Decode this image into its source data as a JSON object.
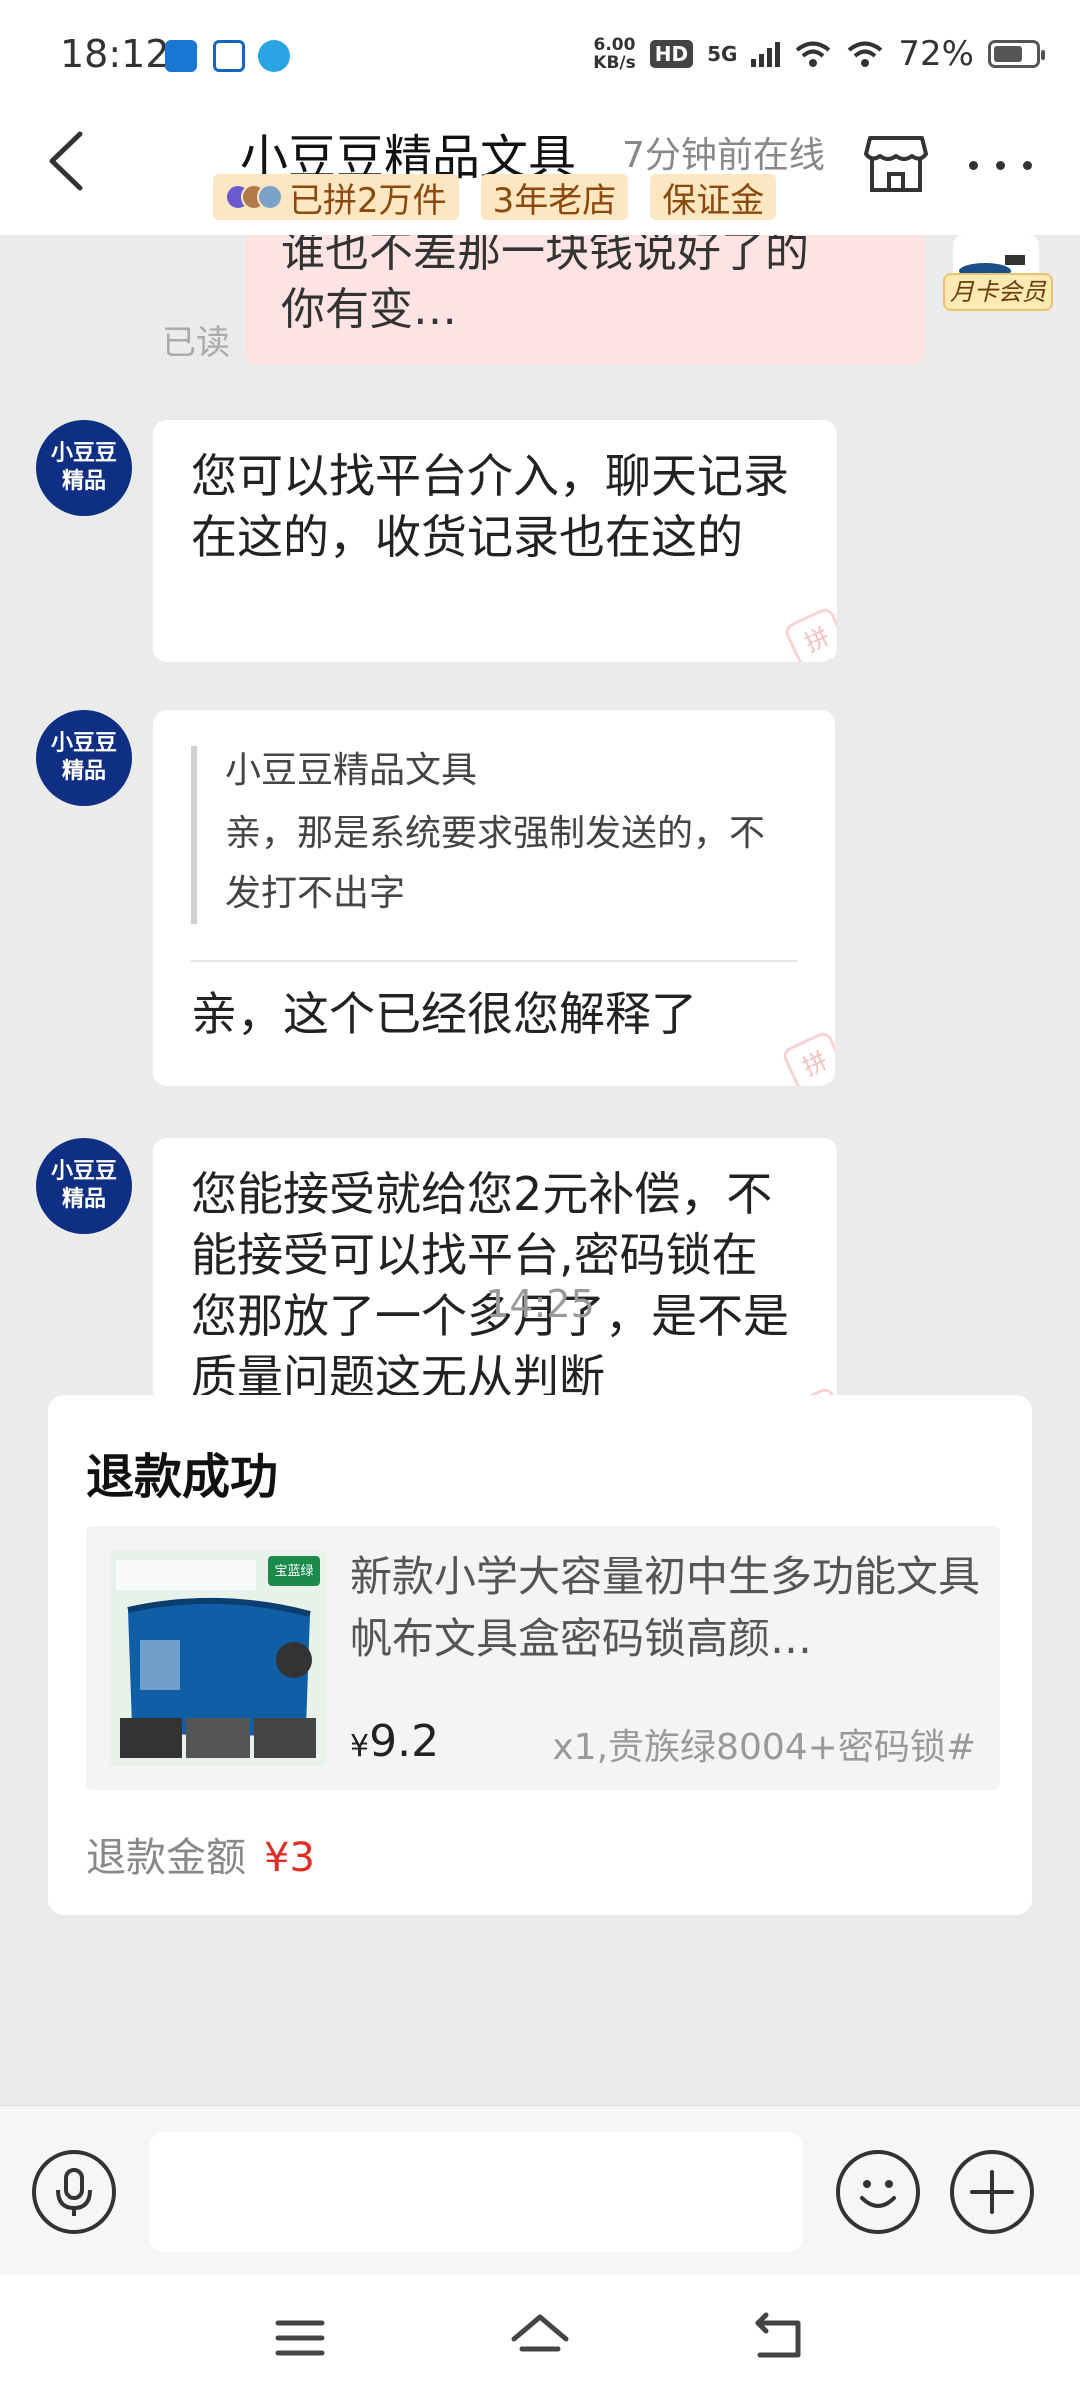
{
  "status_bar": {
    "time": "18:12",
    "net_speed_value": "6.00",
    "net_speed_unit": "KB/s",
    "hd_label": "HD",
    "network_label": "5G",
    "battery_percent": "72%",
    "battery_level": 0.72
  },
  "header": {
    "shop_name": "小豆豆精品文具",
    "online_status": "7分钟前在线",
    "badges": [
      "已拼2万件",
      "3年老店",
      "保证金"
    ],
    "icons": [
      "back-arrow-icon",
      "store-icon",
      "more-icon"
    ]
  },
  "messages": {
    "outgoing_text_line1": "谁也不差那一块钱说好了的",
    "outgoing_text_line2": "你有变…",
    "read_status": "已读",
    "member_badge": "月卡会员",
    "shop_avatar_line1": "小豆豆",
    "shop_avatar_line2": "精品",
    "msg1": "您可以找平台介入，聊天记录在这的，收货记录也在这的",
    "msg2_quote_author": "小豆豆精品文具",
    "msg2_quote_text": "亲，那是系统要求强制发送的，不发打不出字",
    "msg2_reply": "亲，这个已经很您解释了",
    "msg3": "您能接受就给您2元补偿，不能接受可以找平台,密码锁在您那放了一个多月了，是不是质量问题这无从判断",
    "pin_mark": "拼",
    "timestamp": "14:25"
  },
  "refund_card": {
    "title": "退款成功",
    "product_name": "新款小学大容量初中生多功能文具帆布文具盒密码锁高颜…",
    "price_symbol": "¥",
    "price_value": "9.2",
    "spec": "x1,贵族绿8004+密码锁#",
    "amount_label": "退款金额",
    "amount_value": "¥3",
    "product_image_tag": "宝蓝绿"
  },
  "input_bar": {
    "placeholder": "",
    "icons": [
      "microphone-icon",
      "emoji-icon",
      "plus-icon"
    ]
  },
  "nav_bar": {
    "icons": [
      "menu-icon",
      "home-icon",
      "back-icon"
    ]
  },
  "colors": {
    "accent_red": "#e02e24",
    "badge_bg": "#fde6c2",
    "shop_avatar_bg": "#0e2f84",
    "outgoing_bubble": "#fde3e3"
  }
}
